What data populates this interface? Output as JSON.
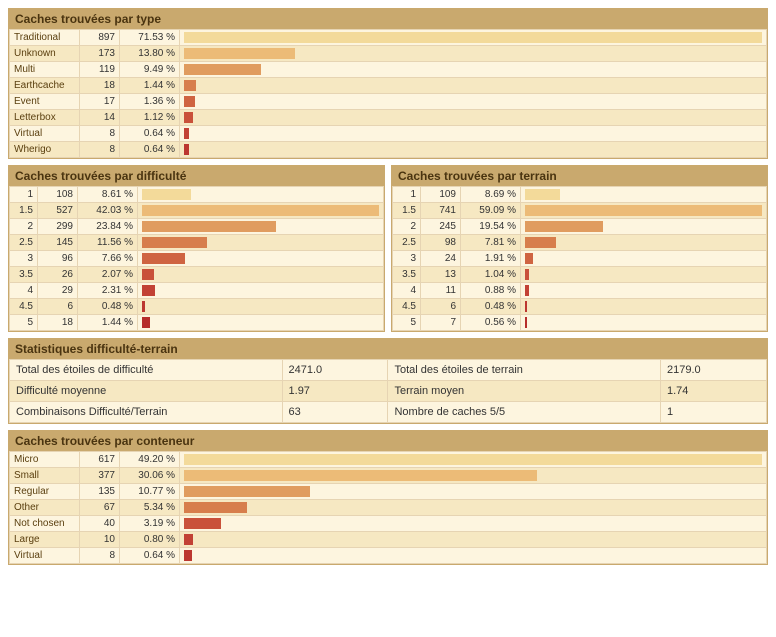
{
  "type_panel": {
    "title": "Caches trouvées par type",
    "rows": [
      {
        "label": "Traditional",
        "count": 897,
        "pct": "71.53 %",
        "bar": 100.0
      },
      {
        "label": "Unknown",
        "count": 173,
        "pct": "13.80 %",
        "bar": 19.29
      },
      {
        "label": "Multi",
        "count": 119,
        "pct": "9.49 %",
        "bar": 13.27
      },
      {
        "label": "Earthcache",
        "count": 18,
        "pct": "1.44 %",
        "bar": 2.01
      },
      {
        "label": "Event",
        "count": 17,
        "pct": "1.36 %",
        "bar": 1.9
      },
      {
        "label": "Letterbox",
        "count": 14,
        "pct": "1.12 %",
        "bar": 1.56
      },
      {
        "label": "Virtual",
        "count": 8,
        "pct": "0.64 %",
        "bar": 0.89
      },
      {
        "label": "Wherigo",
        "count": 8,
        "pct": "0.64 %",
        "bar": 0.89
      }
    ]
  },
  "diff_panel": {
    "title": "Caches trouvées par difficulté",
    "rows": [
      {
        "label": "1",
        "count": 108,
        "pct": "8.61 %",
        "bar": 20.49
      },
      {
        "label": "1.5",
        "count": 527,
        "pct": "42.03 %",
        "bar": 100.0
      },
      {
        "label": "2",
        "count": 299,
        "pct": "23.84 %",
        "bar": 56.74
      },
      {
        "label": "2.5",
        "count": 145,
        "pct": "11.56 %",
        "bar": 27.51
      },
      {
        "label": "3",
        "count": 96,
        "pct": "7.66 %",
        "bar": 18.22
      },
      {
        "label": "3.5",
        "count": 26,
        "pct": "2.07 %",
        "bar": 4.93
      },
      {
        "label": "4",
        "count": 29,
        "pct": "2.31 %",
        "bar": 5.5
      },
      {
        "label": "4.5",
        "count": 6,
        "pct": "0.48 %",
        "bar": 1.14
      },
      {
        "label": "5",
        "count": 18,
        "pct": "1.44 %",
        "bar": 3.42
      }
    ]
  },
  "terrain_panel": {
    "title": "Caches trouvées par terrain",
    "rows": [
      {
        "label": "1",
        "count": 109,
        "pct": "8.69 %",
        "bar": 14.71
      },
      {
        "label": "1.5",
        "count": 741,
        "pct": "59.09 %",
        "bar": 100.0
      },
      {
        "label": "2",
        "count": 245,
        "pct": "19.54 %",
        "bar": 33.06
      },
      {
        "label": "2.5",
        "count": 98,
        "pct": "7.81 %",
        "bar": 13.23
      },
      {
        "label": "3",
        "count": 24,
        "pct": "1.91 %",
        "bar": 3.24
      },
      {
        "label": "3.5",
        "count": 13,
        "pct": "1.04 %",
        "bar": 1.75
      },
      {
        "label": "4",
        "count": 11,
        "pct": "0.88 %",
        "bar": 1.48
      },
      {
        "label": "4.5",
        "count": 6,
        "pct": "0.48 %",
        "bar": 0.81
      },
      {
        "label": "5",
        "count": 7,
        "pct": "0.56 %",
        "bar": 0.94
      }
    ]
  },
  "stats_panel": {
    "title": "Statistiques difficulté-terrain",
    "rows": [
      {
        "l1": "Total des étoiles de difficulté",
        "v1": "2471.0",
        "l2": "Total des étoiles de terrain",
        "v2": "2179.0"
      },
      {
        "l1": "Difficulté moyenne",
        "v1": "1.97",
        "l2": "Terrain moyen",
        "v2": "1.74"
      },
      {
        "l1": "Combinaisons Difficulté/Terrain",
        "v1": "63",
        "l2": "Nombre de caches 5/5",
        "v2": "1"
      }
    ]
  },
  "container_panel": {
    "title": "Caches trouvées par conteneur",
    "rows": [
      {
        "label": "Micro",
        "count": 617,
        "pct": "49.20 %",
        "bar": 100.0
      },
      {
        "label": "Small",
        "count": 377,
        "pct": "30.06 %",
        "bar": 61.1
      },
      {
        "label": "Regular",
        "count": 135,
        "pct": "10.77 %",
        "bar": 21.88
      },
      {
        "label": "Other",
        "count": 67,
        "pct": "5.34 %",
        "bar": 10.86
      },
      {
        "label": "Not chosen",
        "count": 40,
        "pct": "3.19 %",
        "bar": 6.48
      },
      {
        "label": "Large",
        "count": 10,
        "pct": "0.80 %",
        "bar": 1.62
      },
      {
        "label": "Virtual",
        "count": 8,
        "pct": "0.64 %",
        "bar": 1.3
      }
    ]
  },
  "bar_colors": [
    "#f3da9a",
    "#ecbb77",
    "#e09c5f",
    "#d77e4c",
    "#cf6441",
    "#c9513a",
    "#c24235",
    "#bc3730",
    "#b62d2b"
  ]
}
